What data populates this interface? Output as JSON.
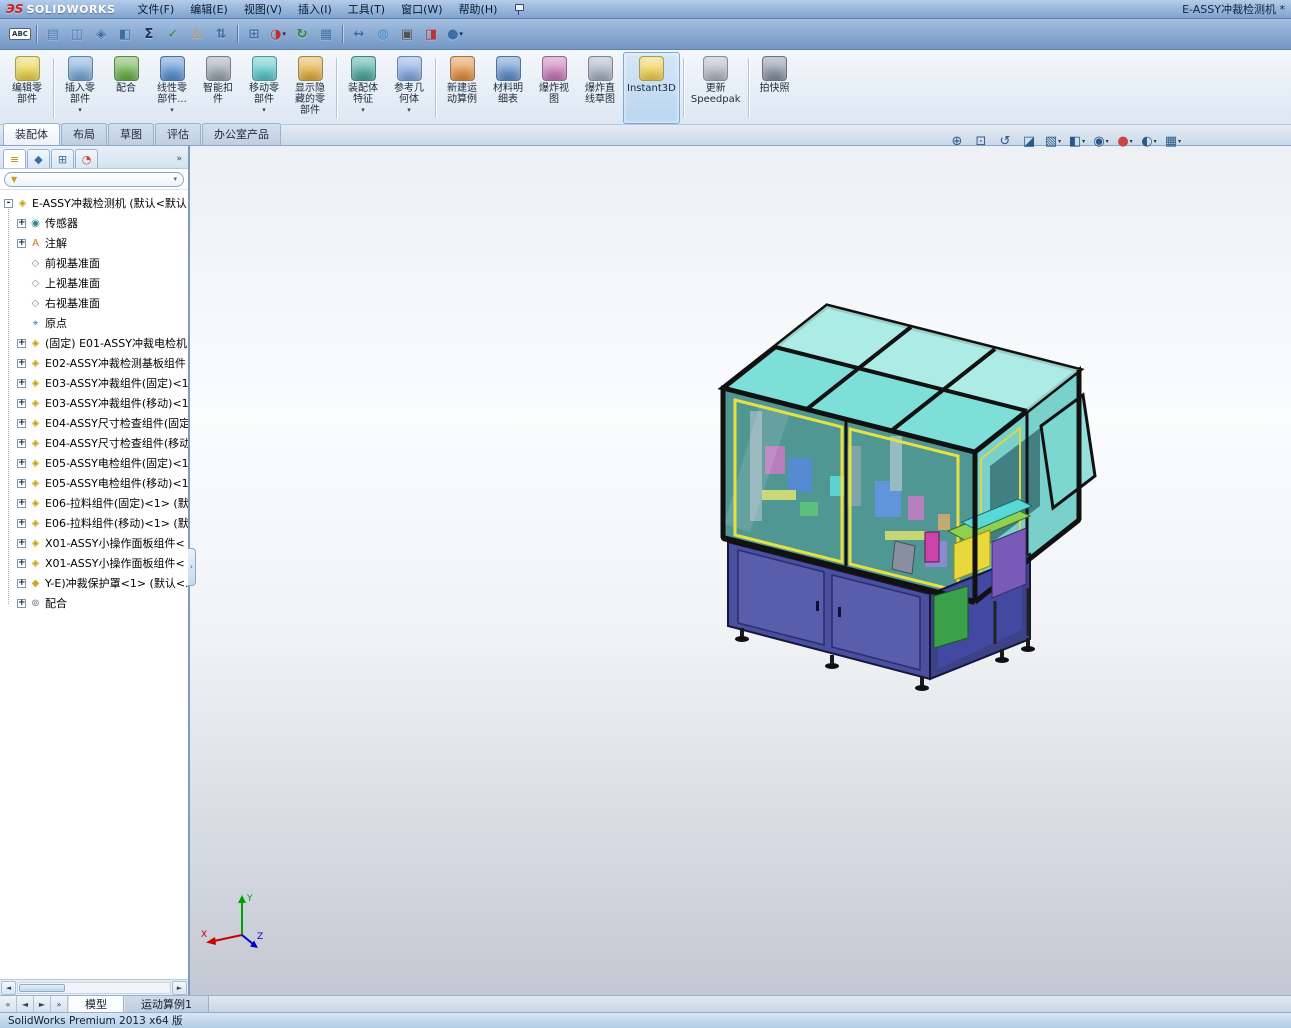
{
  "titlebar": {
    "logo_glyph": "ЭS",
    "logo_text": "SOLIDWORKS",
    "document_title": "E-ASSY冲裁检测机 *",
    "menus": [
      {
        "label": "文件(F)"
      },
      {
        "label": "编辑(E)"
      },
      {
        "label": "视图(V)"
      },
      {
        "label": "插入(I)"
      },
      {
        "label": "工具(T)"
      },
      {
        "label": "窗口(W)"
      },
      {
        "label": "帮助(H)"
      }
    ]
  },
  "qat": {
    "caret_glyph": "▾",
    "icons": [
      {
        "name": "spellcheck-icon",
        "glyph": "ABC",
        "color": "#223344",
        "wide": true
      },
      {
        "sep": true
      },
      {
        "name": "file-properties-icon",
        "glyph": "▤",
        "color": "#4a7ab0"
      },
      {
        "name": "compare-documents-icon",
        "glyph": "◫",
        "color": "#4a7ab0"
      },
      {
        "name": "mass-properties-icon",
        "glyph": "◈",
        "color": "#3a6ea5"
      },
      {
        "name": "section-properties-icon",
        "glyph": "◧",
        "color": "#3a6ea5"
      },
      {
        "name": "equations-icon",
        "glyph": "Σ",
        "color": "#223355"
      },
      {
        "name": "check-document-icon",
        "glyph": "✓",
        "color": "#2a8a2a"
      },
      {
        "name": "interference-detection-icon",
        "glyph": "⚠",
        "color": "#d09020"
      },
      {
        "name": "align-components-icon",
        "glyph": "⇅",
        "color": "#3a6ea5"
      },
      {
        "sep": true
      },
      {
        "name": "insert-component-icon",
        "glyph": "⊞",
        "color": "#3a6ea5"
      },
      {
        "name": "edit-appearance-icon",
        "glyph": "◑",
        "color": "#c03030",
        "dropdown": true
      },
      {
        "name": "rebuild-icon",
        "glyph": "↻",
        "color": "#2a8a2a"
      },
      {
        "name": "pattern-table-icon",
        "glyph": "▦",
        "color": "#3a6ea5"
      },
      {
        "sep": true
      },
      {
        "name": "measure-icon",
        "glyph": "↔",
        "color": "#3a6ea5"
      },
      {
        "name": "apply-scene-icon",
        "glyph": "◍",
        "color": "#3a8ad0"
      },
      {
        "name": "screen-capture-icon",
        "glyph": "▣",
        "color": "#555555"
      },
      {
        "name": "appearance-toggle-icon",
        "glyph": "◨",
        "color": "#c03030"
      },
      {
        "name": "more-commands-icon",
        "glyph": "●",
        "color": "#3a6ea5",
        "dropdown": true
      }
    ]
  },
  "ribbon": {
    "caret_glyph": "▾",
    "buttons": [
      {
        "label": "编辑零\n部件",
        "color": "#e8d44a"
      },
      {
        "sep": true
      },
      {
        "label": "插入零\n部件",
        "color": "#7aa8d8",
        "dropdown": true
      },
      {
        "label": "配合",
        "color": "#6ab04c"
      },
      {
        "label": "线性零\n部件...",
        "color": "#5a8fd0",
        "dropdown": true
      },
      {
        "label": "智能扣\n件",
        "color": "#9aa5b0"
      },
      {
        "label": "移动零\n部件",
        "color": "#5ac8c8",
        "dropdown": true
      },
      {
        "label": "显示隐\n藏的零\n部件",
        "color": "#e0b040"
      },
      {
        "sep": true
      },
      {
        "label": "装配体\n特征",
        "color": "#4aa8a0",
        "dropdown": true
      },
      {
        "label": "参考几\n何体",
        "color": "#88a8e0",
        "dropdown": true
      },
      {
        "sep": true
      },
      {
        "label": "新建运\n动算例",
        "color": "#e09040"
      },
      {
        "label": "材料明\n细表",
        "color": "#6090c8"
      },
      {
        "label": "爆炸视\n图",
        "color": "#c878b8"
      },
      {
        "label": "爆炸直\n线草图",
        "color": "#a8b0c0"
      },
      {
        "label": "Instant3D",
        "color": "#f0d050",
        "active": true
      },
      {
        "sep": true
      },
      {
        "label": "更新\nSpeedpak",
        "color": "#b0b8c4"
      },
      {
        "sep": true
      },
      {
        "label": "拍快照",
        "color": "#8890a0"
      }
    ],
    "tabs": [
      {
        "label": "装配体",
        "active": true
      },
      {
        "label": "布局"
      },
      {
        "label": "草图"
      },
      {
        "label": "评估"
      },
      {
        "label": "办公室产品"
      }
    ]
  },
  "headsup": {
    "caret_glyph": "▾",
    "icons": [
      {
        "name": "zoom-to-fit-icon",
        "glyph": "⊕",
        "color": "#2a5a8a"
      },
      {
        "name": "zoom-to-area-icon",
        "glyph": "⊡",
        "color": "#2a5a8a"
      },
      {
        "name": "previous-view-icon",
        "glyph": "↺",
        "color": "#2a5a8a"
      },
      {
        "name": "section-view-icon",
        "glyph": "◪",
        "color": "#2a5a8a"
      },
      {
        "name": "view-orientation-icon",
        "glyph": "▧",
        "color": "#2a5a8a",
        "dropdown": true
      },
      {
        "name": "display-style-icon",
        "glyph": "◧",
        "color": "#2a5a8a",
        "dropdown": true
      },
      {
        "name": "hide-show-items-icon",
        "glyph": "◉",
        "color": "#2a5a8a",
        "dropdown": true
      },
      {
        "name": "edit-appearance-icon",
        "glyph": "●",
        "color": "#cc4444",
        "dropdown": true
      },
      {
        "name": "apply-scene-icon",
        "glyph": "◐",
        "color": "#2a5a8a",
        "dropdown": true
      },
      {
        "name": "view-settings-icon",
        "glyph": "▦",
        "color": "#2a5a8a",
        "dropdown": true
      }
    ]
  },
  "panel": {
    "expand_glyph": "»",
    "handle_glyph": "›",
    "hscroll_left": "◄",
    "hscroll_right": "►",
    "filter": {
      "funnel_glyph": "▼",
      "caret": "▾"
    },
    "tabs": [
      {
        "name": "featuremanager-tab",
        "glyph": "≡",
        "color": "#b8860b",
        "active": true
      },
      {
        "name": "propertymanager-tab",
        "glyph": "◆",
        "color": "#3a6ea5"
      },
      {
        "name": "configurationmanager-tab",
        "glyph": "⊞",
        "color": "#3a6ea5"
      },
      {
        "name": "displaymanager-tab",
        "glyph": "◔",
        "color": "#cc4444"
      }
    ],
    "tree": [
      {
        "label": "E-ASSY冲裁检测机 (默认<默认",
        "glyph": "◈",
        "color": "#c8a000",
        "expander": "-",
        "indent": 0
      },
      {
        "label": "传感器",
        "glyph": "◉",
        "color": "#2a8a8a",
        "expander": "+",
        "indent": 1
      },
      {
        "label": "注解",
        "glyph": "A",
        "color": "#c87820",
        "expander": "+",
        "indent": 1
      },
      {
        "label": "前视基准面",
        "glyph": "◇",
        "color": "#7788aa",
        "expander": "",
        "indent": 1
      },
      {
        "label": "上视基准面",
        "glyph": "◇",
        "color": "#7788aa",
        "expander": "",
        "indent": 1
      },
      {
        "label": "右视基准面",
        "glyph": "◇",
        "color": "#7788aa",
        "expander": "",
        "indent": 1
      },
      {
        "label": "原点",
        "glyph": "⌖",
        "color": "#3366cc",
        "expander": "",
        "indent": 1
      },
      {
        "label": "(固定) E01-ASSY冲裁电检机",
        "glyph": "◈",
        "color": "#c8a000",
        "expander": "+",
        "indent": 1
      },
      {
        "label": "E02-ASSY冲裁检测基板组件",
        "glyph": "◈",
        "color": "#c8a000",
        "expander": "+",
        "indent": 1
      },
      {
        "label": "E03-ASSY冲裁组件(固定)<1",
        "glyph": "◈",
        "color": "#c8a000",
        "expander": "+",
        "indent": 1
      },
      {
        "label": "E03-ASSY冲裁组件(移动)<1",
        "glyph": "◈",
        "color": "#c8a000",
        "expander": "+",
        "indent": 1
      },
      {
        "label": "E04-ASSY尺寸检查组件(固定",
        "glyph": "◈",
        "color": "#c8a000",
        "expander": "+",
        "indent": 1
      },
      {
        "label": "E04-ASSY尺寸检查组件(移动",
        "glyph": "◈",
        "color": "#c8a000",
        "expander": "+",
        "indent": 1
      },
      {
        "label": "E05-ASSY电检组件(固定)<1",
        "glyph": "◈",
        "color": "#c8a000",
        "expander": "+",
        "indent": 1
      },
      {
        "label": "E05-ASSY电检组件(移动)<1",
        "glyph": "◈",
        "color": "#c8a000",
        "expander": "+",
        "indent": 1
      },
      {
        "label": "E06-拉料组件(固定)<1> (默",
        "glyph": "◈",
        "color": "#c8a000",
        "expander": "+",
        "indent": 1
      },
      {
        "label": "E06-拉料组件(移动)<1> (默",
        "glyph": "◈",
        "color": "#c8a000",
        "expander": "+",
        "indent": 1
      },
      {
        "label": "X01-ASSY小操作面板组件<",
        "glyph": "◈",
        "color": "#c8a000",
        "expander": "+",
        "indent": 1
      },
      {
        "label": "X01-ASSY小操作面板组件<",
        "glyph": "◈",
        "color": "#c8a000",
        "expander": "+",
        "indent": 1
      },
      {
        "label": "Y-E)冲裁保护罩<1> (默认<...",
        "glyph": "◆",
        "color": "#d0a820",
        "expander": "+",
        "indent": 1
      },
      {
        "label": "配合",
        "glyph": "⊚",
        "color": "#667788",
        "expander": "+",
        "indent": 1
      }
    ]
  },
  "doctabs": {
    "nav": [
      {
        "glyph": "«"
      },
      {
        "glyph": "◄"
      },
      {
        "glyph": "►"
      },
      {
        "glyph": "»"
      }
    ],
    "tabs": [
      {
        "label": "模型",
        "active": true
      },
      {
        "label": "运动算例1"
      }
    ]
  },
  "statusbar": {
    "text": "SolidWorks Premium 2013 x64 版"
  },
  "viewport": {
    "triad": {
      "x_label": "X",
      "y_label": "Y",
      "z_label": "Z"
    }
  }
}
